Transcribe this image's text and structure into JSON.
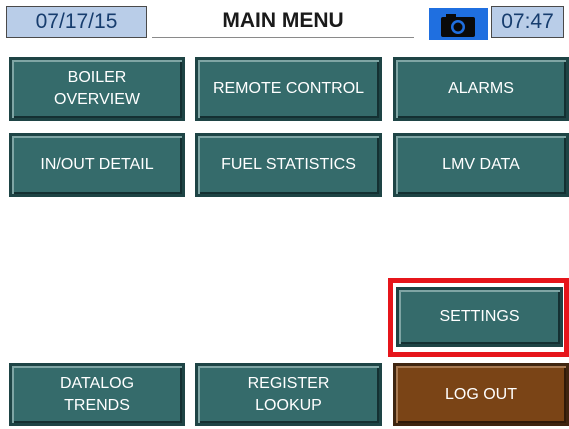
{
  "header": {
    "date": "07/17/15",
    "title": "MAIN MENU",
    "camera_icon": "camera-icon",
    "time": "07:47"
  },
  "menu": {
    "boiler_overview": [
      "BOILER",
      "OVERVIEW"
    ],
    "remote_control": "REMOTE CONTROL",
    "alarms": "ALARMS",
    "in_out_detail": "IN/OUT DETAIL",
    "fuel_statistics": "FUEL STATISTICS",
    "lmv_data": "LMV DATA",
    "settings": "SETTINGS",
    "datalog_trends": [
      "DATALOG",
      "TRENDS"
    ],
    "register_lookup": [
      "REGISTER",
      "LOOKUP"
    ],
    "log_out": "LOG OUT"
  },
  "colors": {
    "button_teal": "#356b6b",
    "logout_brown": "#7a4416",
    "highlight_red": "#e6151b",
    "header_blue": "#b9cde8"
  }
}
